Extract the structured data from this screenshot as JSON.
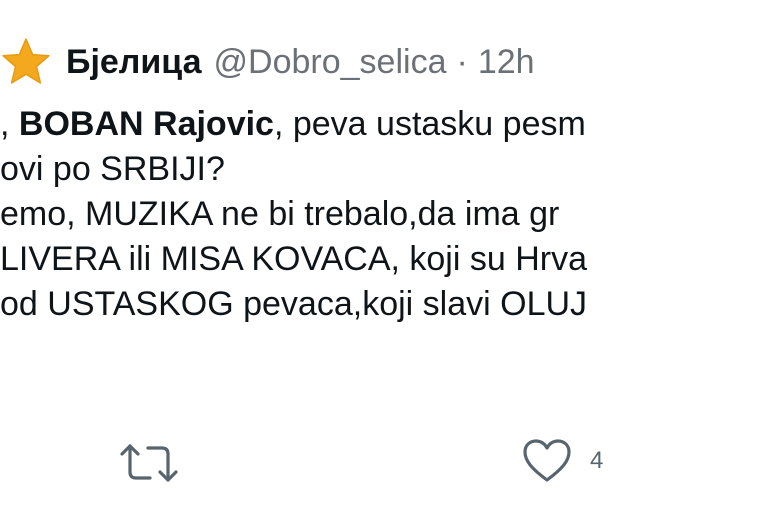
{
  "tweet": {
    "author_name": "Бјелица",
    "handle": "@Dobro_selica",
    "separator": "·",
    "time": "12h",
    "lines": [
      {
        "pre": ", ",
        "bold": "BOBAN Rajovic",
        "post": ", peva ustasku pesm"
      },
      {
        "text": "ovi po SRBIJI?"
      },
      {
        "text": "emo, MUZIKA ne bi trebalo,da ima gr"
      },
      {
        "text": "LIVERA ili MISA KOVACA, koji su Hrva"
      },
      {
        "text": "od USTASKOG pevaca,koji slavi OLUJ"
      }
    ],
    "actions": {
      "retweet_icon": "retweet-icon",
      "like_icon": "heart-icon",
      "like_count": "4"
    },
    "colors": {
      "star": "#f4a81d",
      "text": "#0f1419",
      "muted": "#6b7177",
      "icon": "#58646e"
    }
  }
}
